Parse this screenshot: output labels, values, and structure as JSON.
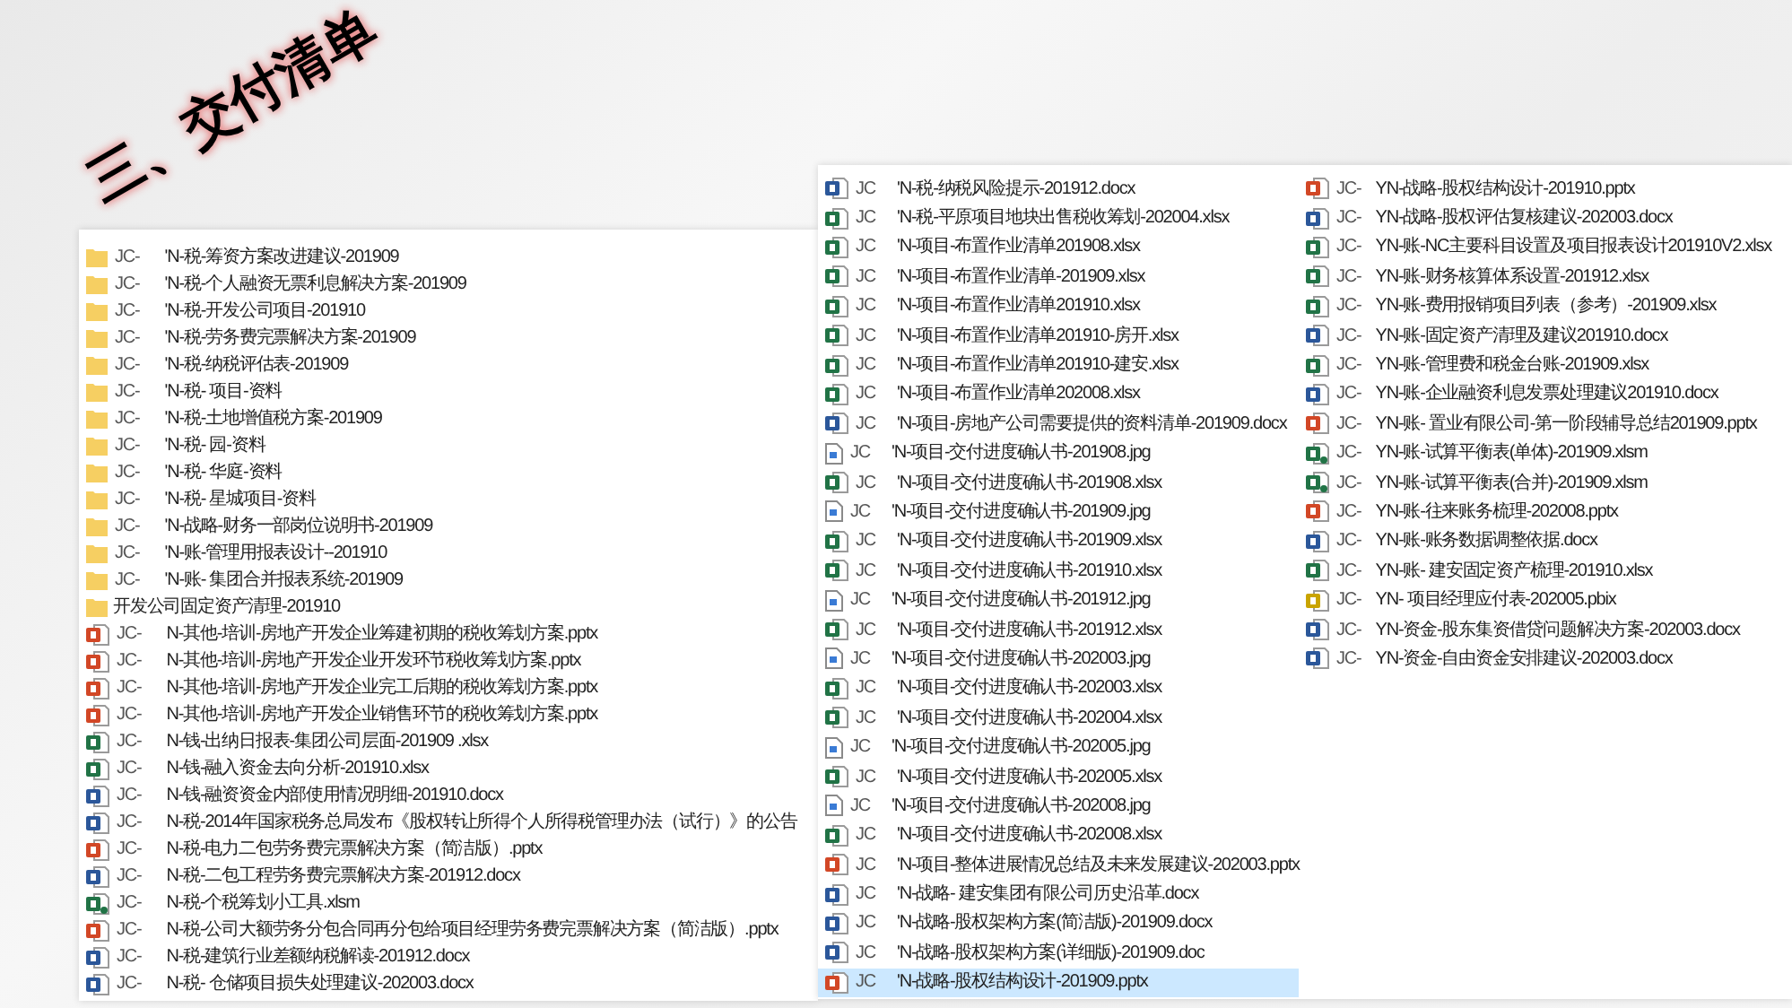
{
  "title": "三、交付清单",
  "left_list": [
    {
      "kind": "folder",
      "prefix": "JC-",
      "name": "'N-税-筹资方案改进建议-201909",
      "selected": false
    },
    {
      "kind": "folder",
      "prefix": "JC-",
      "name": "'N-税-个人融资无票利息解决方案-201909",
      "selected": false
    },
    {
      "kind": "folder",
      "prefix": "JC-",
      "name": "'N-税-开发公司项目-201910",
      "selected": false
    },
    {
      "kind": "folder",
      "prefix": "JC-",
      "name": "'N-税-劳务费完票解决方案-201909",
      "selected": false
    },
    {
      "kind": "folder",
      "prefix": "JC-",
      "name": "'N-税-纳税评估表-201909",
      "selected": false
    },
    {
      "kind": "folder",
      "prefix": "JC-",
      "name": "'N-税- 项目-资料",
      "selected": false
    },
    {
      "kind": "folder",
      "prefix": "JC-",
      "name": "'N-税-土地增值税方案-201909",
      "selected": false
    },
    {
      "kind": "folder",
      "prefix": "JC-",
      "name": "'N-税- 园-资料",
      "selected": false
    },
    {
      "kind": "folder",
      "prefix": "JC-",
      "name": "'N-税- 华庭-资料",
      "selected": false
    },
    {
      "kind": "folder",
      "prefix": "JC-",
      "name": "'N-税- 星城项目-资料",
      "selected": false
    },
    {
      "kind": "folder",
      "prefix": "JC-",
      "name": "'N-战略-财务一部岗位说明书-201909",
      "selected": false
    },
    {
      "kind": "folder",
      "prefix": "JC-",
      "name": "'N-账-管理用报表设计--201910",
      "selected": false
    },
    {
      "kind": "folder",
      "prefix": "JC-",
      "name": "'N-账- 集团合并报表系统-201909",
      "selected": false
    },
    {
      "kind": "folder",
      "name": "开发公司固定资产清理-201910",
      "selected": false
    },
    {
      "kind": "pptx",
      "prefix": "JC-",
      "name": "N-其他-培训-房地产开发企业筹建初期的税收筹划方案.pptx",
      "selected": false
    },
    {
      "kind": "pptx",
      "prefix": "JC-",
      "name": "N-其他-培训-房地产开发企业开发环节税收筹划方案.pptx",
      "selected": false
    },
    {
      "kind": "pptx",
      "prefix": "JC-",
      "name": "N-其他-培训-房地产开发企业完工后期的税收筹划方案.pptx",
      "selected": false
    },
    {
      "kind": "pptx",
      "prefix": "JC-",
      "name": "N-其他-培训-房地产开发企业销售环节的税收筹划方案.pptx",
      "selected": false
    },
    {
      "kind": "xlsx",
      "prefix": "JC-",
      "name": "N-钱-出纳日报表-集团公司层面-201909 .xlsx",
      "selected": false
    },
    {
      "kind": "xlsx",
      "prefix": "JC-",
      "name": "N-钱-融入资金去向分析-201910.xlsx",
      "selected": false
    },
    {
      "kind": "docx",
      "prefix": "JC-",
      "name": "N-钱-融资资金内部使用情况明细-201910.docx",
      "selected": false
    },
    {
      "kind": "docx",
      "prefix": "JC-",
      "name": "N-税-2014年国家税务总局发布《股权转让所得个人所得税管理办法（试行）》的公告",
      "selected": false
    },
    {
      "kind": "pptx",
      "prefix": "JC-",
      "name": "N-税-电力二包劳务费完票解决方案（简洁版）.pptx",
      "selected": false
    },
    {
      "kind": "docx",
      "prefix": "JC-",
      "name": "N-税-二包工程劳务费完票解决方案-201912.docx",
      "selected": false
    },
    {
      "kind": "xlsm",
      "prefix": "JC-",
      "name": "N-税-个税筹划小工具.xlsm",
      "selected": false
    },
    {
      "kind": "pptx",
      "prefix": "JC-",
      "name": "N-税-公司大额劳务分包合同再分包给项目经理劳务费完票解决方案（简洁版）.pptx",
      "selected": false
    },
    {
      "kind": "docx",
      "prefix": "JC-",
      "name": "N-税-建筑行业差额纳税解读-201912.docx",
      "selected": false
    },
    {
      "kind": "docx",
      "prefix": "JC-",
      "name": "N-税- 仓储项目损失处理建议-202003.docx",
      "selected": false
    }
  ],
  "right_panel": {
    "column_1": [
      {
        "kind": "docx",
        "prefix": "JC",
        "name": "'N-税-纳税风险提示-201912.docx",
        "selected": false
      },
      {
        "kind": "xlsx",
        "prefix": "JC",
        "name": "'N-税-平原项目地块出售税收筹划-202004.xlsx",
        "selected": false
      },
      {
        "kind": "xlsx",
        "prefix": "JC",
        "name": "'N-项目-布置作业清单201908.xlsx",
        "selected": false
      },
      {
        "kind": "xlsx",
        "prefix": "JC",
        "name": "'N-项目-布置作业清单-201909.xlsx",
        "selected": false
      },
      {
        "kind": "xlsx",
        "prefix": "JC",
        "name": "'N-项目-布置作业清单201910.xlsx",
        "selected": false
      },
      {
        "kind": "xlsx",
        "prefix": "JC",
        "name": "'N-项目-布置作业清单201910-房开.xlsx",
        "selected": false
      },
      {
        "kind": "xlsx",
        "prefix": "JC",
        "name": "'N-项目-布置作业清单201910-建安.xlsx",
        "selected": false
      },
      {
        "kind": "xlsx",
        "prefix": "JC",
        "name": "'N-项目-布置作业清单202008.xlsx",
        "selected": false
      },
      {
        "kind": "docx",
        "prefix": "JC",
        "name": "'N-项目-房地产公司需要提供的资料清单-201909.docx",
        "selected": false
      },
      {
        "kind": "jpg",
        "prefix": "JC",
        "name": "'N-项目-交付进度确认书-201908.jpg",
        "selected": false
      },
      {
        "kind": "xlsx",
        "prefix": "JC",
        "name": "'N-项目-交付进度确认书-201908.xlsx",
        "selected": false
      },
      {
        "kind": "jpg",
        "prefix": "JC",
        "name": "'N-项目-交付进度确认书-201909.jpg",
        "selected": false
      },
      {
        "kind": "xlsx",
        "prefix": "JC",
        "name": "'N-项目-交付进度确认书-201909.xlsx",
        "selected": false
      },
      {
        "kind": "xlsx",
        "prefix": "JC",
        "name": "'N-项目-交付进度确认书-201910.xlsx",
        "selected": false
      },
      {
        "kind": "jpg",
        "prefix": "JC",
        "name": "'N-项目-交付进度确认书-201912.jpg",
        "selected": false
      },
      {
        "kind": "xlsx",
        "prefix": "JC",
        "name": "'N-项目-交付进度确认书-201912.xlsx",
        "selected": false
      },
      {
        "kind": "jpg",
        "prefix": "JC",
        "name": "'N-项目-交付进度确认书-202003.jpg",
        "selected": false
      },
      {
        "kind": "xlsx",
        "prefix": "JC",
        "name": "'N-项目-交付进度确认书-202003.xlsx",
        "selected": false
      },
      {
        "kind": "xlsx",
        "prefix": "JC",
        "name": "'N-项目-交付进度确认书-202004.xlsx",
        "selected": false
      },
      {
        "kind": "jpg",
        "prefix": "JC",
        "name": "'N-项目-交付进度确认书-202005.jpg",
        "selected": false
      },
      {
        "kind": "xlsx",
        "prefix": "JC",
        "name": "'N-项目-交付进度确认书-202005.xlsx",
        "selected": false
      },
      {
        "kind": "jpg",
        "prefix": "JC",
        "name": "'N-项目-交付进度确认书-202008.jpg",
        "selected": false
      },
      {
        "kind": "xlsx",
        "prefix": "JC",
        "name": "'N-项目-交付进度确认书-202008.xlsx",
        "selected": false
      },
      {
        "kind": "pptx",
        "prefix": "JC",
        "name": "'N-项目-整体进展情况总结及未来发展建议-202003.pptx",
        "selected": false
      },
      {
        "kind": "docx",
        "prefix": "JC",
        "name": "'N-战略- 建安集团有限公司历史沿革.docx",
        "selected": false
      },
      {
        "kind": "docx",
        "prefix": "JC",
        "name": "'N-战略-股权架构方案(简洁版)-201909.docx",
        "selected": false
      },
      {
        "kind": "doc",
        "prefix": "JC",
        "name": "'N-战略-股权架构方案(详细版)-201909.doc",
        "selected": false
      },
      {
        "kind": "pptx",
        "prefix": "JC",
        "name": "'N-战略-股权结构设计-201909.pptx",
        "selected": true
      }
    ],
    "column_2": [
      {
        "kind": "pptx",
        "prefix": "JC-",
        "name": "YN-战略-股权结构设计-201910.pptx",
        "selected": false
      },
      {
        "kind": "docx",
        "prefix": "JC-",
        "name": "YN-战略-股权评估复核建议-202003.docx",
        "selected": false
      },
      {
        "kind": "xlsx",
        "prefix": "JC-",
        "name": "YN-账-NC主要科目设置及项目报表设计201910V2.xlsx",
        "selected": false
      },
      {
        "kind": "xlsx",
        "prefix": "JC-",
        "name": "YN-账-财务核算体系设置-201912.xlsx",
        "selected": false
      },
      {
        "kind": "xlsx",
        "prefix": "JC-",
        "name": "YN-账-费用报销项目列表（参考）-201909.xlsx",
        "selected": false
      },
      {
        "kind": "docx",
        "prefix": "JC-",
        "name": "YN-账-固定资产清理及建议201910.docx",
        "selected": false
      },
      {
        "kind": "xlsx",
        "prefix": "JC-",
        "name": "YN-账-管理费和税金台账-201909.xlsx",
        "selected": false
      },
      {
        "kind": "docx",
        "prefix": "JC-",
        "name": "YN-账-企业融资利息发票处理建议201910.docx",
        "selected": false
      },
      {
        "kind": "pptx",
        "prefix": "JC-",
        "name": "YN-账- 置业有限公司-第一阶段辅导总结201909.pptx",
        "selected": false
      },
      {
        "kind": "xlsm",
        "prefix": "JC-",
        "name": "YN-账-试算平衡表(单体)-201909.xlsm",
        "selected": false
      },
      {
        "kind": "xlsm",
        "prefix": "JC-",
        "name": "YN-账-试算平衡表(合并)-201909.xlsm",
        "selected": false
      },
      {
        "kind": "pptx",
        "prefix": "JC-",
        "name": "YN-账-往来账务梳理-202008.pptx",
        "selected": false
      },
      {
        "kind": "docx",
        "prefix": "JC-",
        "name": "YN-账-账务数据调整依据.docx",
        "selected": false
      },
      {
        "kind": "xlsx",
        "prefix": "JC-",
        "name": "YN-账- 建安固定资产梳理-201910.xlsx",
        "selected": false
      },
      {
        "kind": "pbix",
        "prefix": "JC-",
        "name": "YN- 项目经理应付表-202005.pbix",
        "selected": false
      },
      {
        "kind": "docx",
        "prefix": "JC-",
        "name": "YN-资金-股东集资借贷问题解决方案-202003.docx",
        "selected": false
      },
      {
        "kind": "docx",
        "prefix": "JC-",
        "name": "YN-资金-自由资金安排建议-202003.docx",
        "selected": false
      }
    ]
  }
}
